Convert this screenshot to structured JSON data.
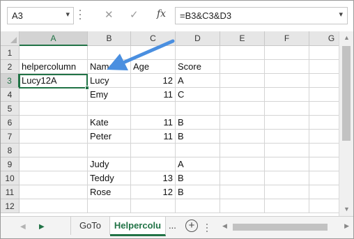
{
  "formula_bar": {
    "name_box": "A3",
    "cancel_glyph": "✕",
    "enter_glyph": "✓",
    "fx_label": "fx",
    "formula": "=B3&C3&D3"
  },
  "columns": [
    "A",
    "B",
    "C",
    "D",
    "E",
    "F",
    "G"
  ],
  "rows": [
    "1",
    "2",
    "3",
    "4",
    "5",
    "6",
    "7",
    "8",
    "9",
    "10",
    "11",
    "12"
  ],
  "cells": {
    "A2": "helpercolumn",
    "B2": "Name",
    "C2": "Age",
    "D2": "Score",
    "A3": "Lucy12A",
    "B3": "Lucy",
    "C3": "12",
    "D3": "A",
    "B4": "Emy",
    "C4": "11",
    "D4": "C",
    "B6": "Kate",
    "C6": "11",
    "D6": "B",
    "B7": "Peter",
    "C7": "11",
    "D7": "B",
    "B9": "Judy",
    "D9": "A",
    "B10": "Teddy",
    "C10": "13",
    "D10": "B",
    "B11": "Rose",
    "C11": "12",
    "D11": "B"
  },
  "numeric_cells": [
    "C3",
    "C4",
    "C6",
    "C7",
    "C10",
    "C11"
  ],
  "selected": {
    "cell": "A3",
    "column": "A",
    "row": "3"
  },
  "sheet_tabs": [
    {
      "label": "GoTo",
      "active": false
    },
    {
      "label": "Helpercolu",
      "active": true
    }
  ],
  "tabs_more": "...",
  "add_sheet": "+",
  "colors": {
    "accent": "#217346",
    "arrow": "#4a8fe0",
    "header_bg": "#e6e6e6"
  },
  "icons": {
    "nav_prev": "triangle-left-icon",
    "nav_next": "triangle-right-icon",
    "add_sheet": "plus-circle-icon",
    "annotation": "arrow-icon"
  }
}
